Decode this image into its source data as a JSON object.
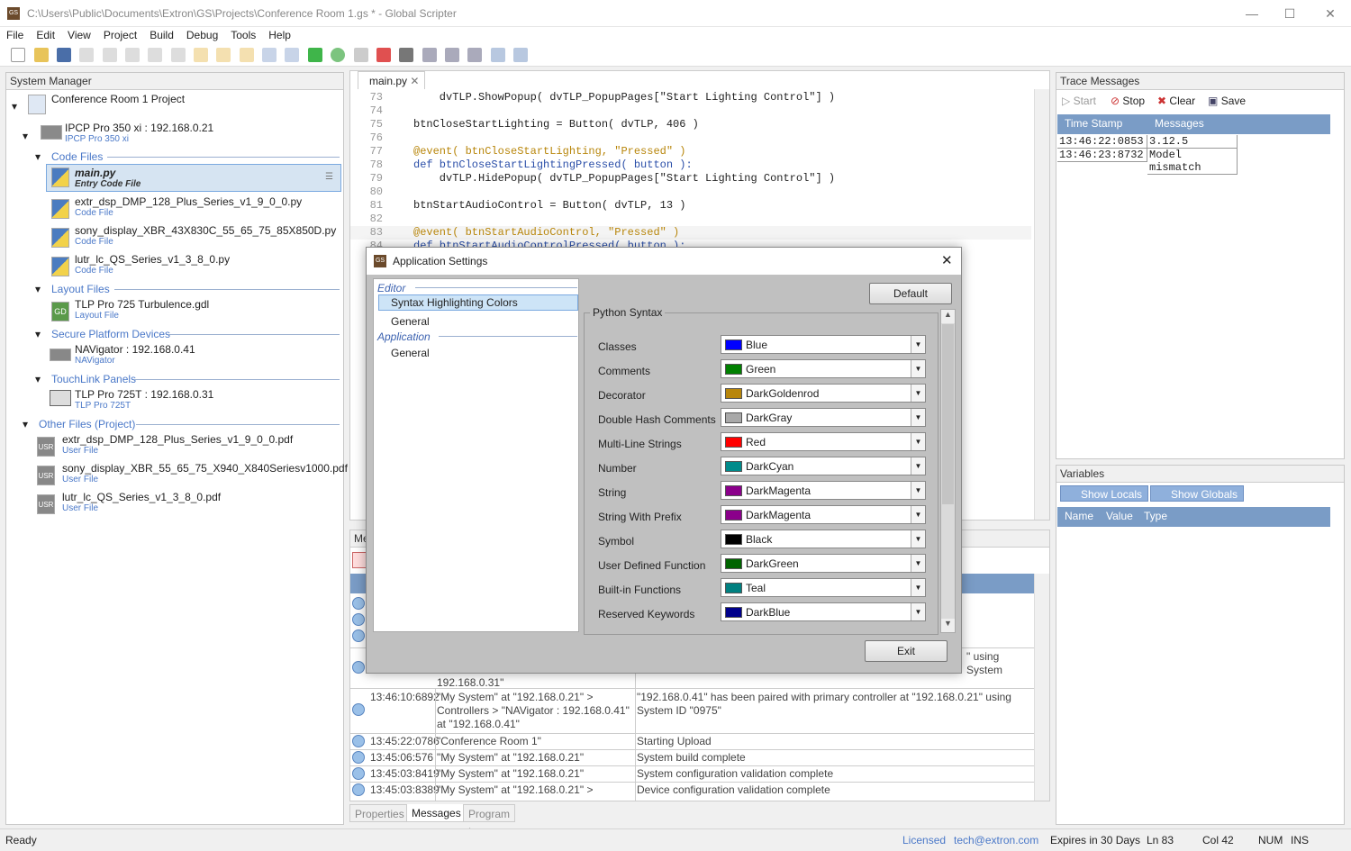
{
  "window": {
    "title": "C:\\Users\\Public\\Documents\\Extron\\GS\\Projects\\Conference Room 1.gs * - Global Scripter",
    "app_icon": "GS"
  },
  "menu": [
    "File",
    "Edit",
    "View",
    "Project",
    "Build",
    "Debug",
    "Tools",
    "Help"
  ],
  "system_manager": {
    "title": "System Manager",
    "project": "Conference Room 1 Project",
    "controller": {
      "name": "IPCP Pro 350 xi : 192.168.0.21",
      "sub": "IPCP Pro 350 xi"
    },
    "groups": {
      "code": "Code Files",
      "layout": "Layout Files",
      "secure": "Secure Platform Devices",
      "touchlink": "TouchLink Panels",
      "other": "Other Files (Project)"
    },
    "code_files": [
      {
        "name": "main.py",
        "sub": "Entry Code File"
      },
      {
        "name": "extr_dsp_DMP_128_Plus_Series_v1_9_0_0.py",
        "sub": "Code File"
      },
      {
        "name": "sony_display_XBR_43X830C_55_65_75_85X850D.py",
        "sub": "Code File"
      },
      {
        "name": "lutr_lc_QS_Series_v1_3_8_0.py",
        "sub": "Code File"
      }
    ],
    "layout_file": {
      "name": "TLP Pro 725 Turbulence.gdl",
      "sub": "Layout File",
      "icon": "GD"
    },
    "secure_device": {
      "name": "NAVigator : 192.168.0.41",
      "sub": "NAVigator"
    },
    "touch_panel": {
      "name": "TLP Pro 725T : 192.168.0.31",
      "sub": "TLP Pro 725T"
    },
    "other_files": [
      {
        "name": "extr_dsp_DMP_128_Plus_Series_v1_9_0_0.pdf",
        "sub": "User File"
      },
      {
        "name": "sony_display_XBR_55_65_75_X940_X840Seriesv1000.pdf",
        "sub": "User File"
      },
      {
        "name": "lutr_lc_QS_Series_v1_3_8_0.pdf",
        "sub": "User File"
      }
    ],
    "usr_label": "USR"
  },
  "editor": {
    "tab": "main.py",
    "lines": [
      {
        "n": "73",
        "t": "    dvTLP.ShowPopup( dvTLP_PopupPages[\"Start Lighting Control\"] )"
      },
      {
        "n": "74",
        "t": ""
      },
      {
        "n": "75",
        "t": "btnCloseStartLighting = Button( dvTLP, 406 )"
      },
      {
        "n": "76",
        "t": ""
      },
      {
        "n": "77",
        "t": "@event( btnCloseStartLighting, \"Pressed\" )"
      },
      {
        "n": "78",
        "t": "def btnCloseStartLightingPressed( button ):"
      },
      {
        "n": "79",
        "t": "    dvTLP.HidePopup( dvTLP_PopupPages[\"Start Lighting Control\"] )"
      },
      {
        "n": "80",
        "t": ""
      },
      {
        "n": "81",
        "t": "btnStartAudioControl = Button( dvTLP, 13 )"
      },
      {
        "n": "82",
        "t": ""
      },
      {
        "n": "83",
        "t": "@event( btnStartAudioControl, \"Pressed\" )"
      },
      {
        "n": "84",
        "t": "def btnStartAudioControlPressed( button ):"
      }
    ]
  },
  "messages": {
    "title": "Me",
    "rows": [
      {
        "time": "",
        "src": "192.168.0.31\"",
        "msg": ""
      },
      {
        "time": "13:46:10:6892",
        "src": "\"My System\" at \"192.168.0.21\" > Controllers > \"NAVigator : 192.168.0.41\" at \"192.168.0.41\"",
        "msg": "\"192.168.0.41\" has been paired with primary controller at \"192.168.0.21\" using System ID \"0975\""
      },
      {
        "time": "13:45:22:0786",
        "src": "\"Conference Room 1\"",
        "msg": "Starting Upload"
      },
      {
        "time": "13:45:06:576",
        "src": "\"My System\" at \"192.168.0.21\"",
        "msg": "System build complete"
      },
      {
        "time": "13:45:03:8419",
        "src": "\"My System\" at \"192.168.0.21\"",
        "msg": "System configuration validation complete"
      },
      {
        "time": "13:45:03:8389",
        "src": "\"My System\" at \"192.168.0.21\" >",
        "msg": "Device configuration validation complete"
      }
    ],
    "partial": "\" using System"
  },
  "bottom_tabs": [
    "Properties",
    "Messages",
    "Program Log"
  ],
  "trace": {
    "title": "Trace Messages",
    "buttons": [
      "Start",
      "Stop",
      "Clear",
      "Save"
    ],
    "headers": [
      "Time Stamp",
      "Messages"
    ],
    "rows": [
      {
        "ts": "13:46:22:0853",
        "msg": "3.12.5"
      },
      {
        "ts": "13:46:23:8732",
        "msg": "Model mismatch"
      }
    ]
  },
  "variables": {
    "title": "Variables",
    "buttons": [
      "Show Locals",
      "Show Globals"
    ],
    "headers": [
      "Name",
      "Value",
      "Type"
    ]
  },
  "status": {
    "ready": "Ready",
    "licensed": "Licensed",
    "email": "tech@extron.com",
    "expires": "Expires in 30 Days",
    "ln": "Ln 83",
    "col": "Col 42",
    "num": "NUM",
    "ins": "INS"
  },
  "dialog": {
    "title": "Application Settings",
    "nav": {
      "editor": "Editor",
      "syntax": "Syntax Highlighting Colors",
      "general1": "General",
      "application": "Application",
      "general2": "General"
    },
    "default_btn": "Default",
    "exit_btn": "Exit",
    "group": "Python Syntax",
    "rows": [
      {
        "label": "Classes",
        "value": "Blue",
        "color": "#0000ff"
      },
      {
        "label": "Comments",
        "value": "Green",
        "color": "#008000"
      },
      {
        "label": "Decorator",
        "value": "DarkGoldenrod",
        "color": "#b8860b"
      },
      {
        "label": "Double Hash Comments",
        "value": "DarkGray",
        "color": "#a9a9a9"
      },
      {
        "label": "Multi-Line Strings",
        "value": "Red",
        "color": "#ff0000"
      },
      {
        "label": "Number",
        "value": "DarkCyan",
        "color": "#008b8b"
      },
      {
        "label": "String",
        "value": "DarkMagenta",
        "color": "#8b008b"
      },
      {
        "label": "String With Prefix",
        "value": "DarkMagenta",
        "color": "#8b008b"
      },
      {
        "label": "Symbol",
        "value": "Black",
        "color": "#000000"
      },
      {
        "label": "User Defined Function",
        "value": "DarkGreen",
        "color": "#006400"
      },
      {
        "label": "Built-in Functions",
        "value": "Teal",
        "color": "#008080"
      },
      {
        "label": "Reserved Keywords",
        "value": "DarkBlue",
        "color": "#00008b"
      }
    ]
  }
}
